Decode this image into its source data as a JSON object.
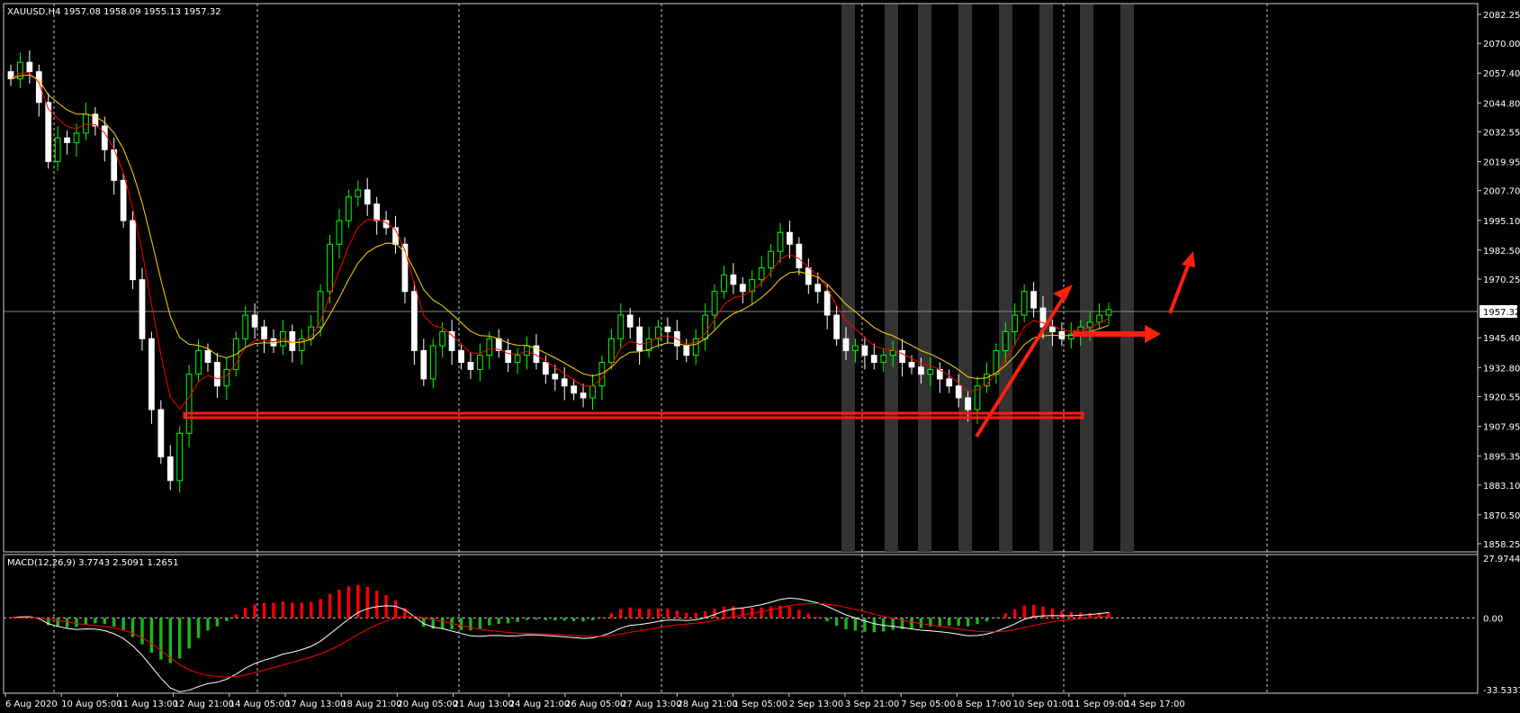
{
  "main_chart": {
    "header": "XAUUSD,H4  1957.08 1958.09 1955.13 1957.32",
    "price_labels": [
      "2082.25",
      "2070.00",
      "2057.40",
      "2044.80",
      "2032.55",
      "2019.95",
      "2007.70",
      "1995.10",
      "1982.50",
      "1970.25",
      "1957.32",
      "1945.40",
      "1932.80",
      "1920.55",
      "1907.95",
      "1895.35",
      "1883.10",
      "1870.50",
      "1858.25"
    ],
    "current_price": "1957.32"
  },
  "macd": {
    "header": "MACD(12,26,9) 3.7743 2.5091 1.2651",
    "scale_labels": [
      "27.9744",
      "0.00",
      "-33.5337"
    ]
  },
  "time_axis": {
    "labels": [
      "6 Aug 2020",
      "10 Aug 05:00",
      "11 Aug 13:00",
      "12 Aug 21:00",
      "14 Aug 05:00",
      "17 Aug 13:00",
      "18 Aug 21:00",
      "20 Aug 05:00",
      "21 Aug 13:00",
      "24 Aug 21:00",
      "26 Aug 05:00",
      "27 Aug 13:00",
      "28 Aug 21:00",
      "1 Sep 05:00",
      "2 Sep 13:00",
      "3 Sep 21:00",
      "7 Sep 05:00",
      "8 Sep 17:00",
      "10 Sep 01:00",
      "11 Sep 09:00",
      "14 Sep 17:00"
    ]
  },
  "chart_data": {
    "type": "candlestick",
    "symbol": "XAUUSD",
    "timeframe": "H4",
    "ylim": [
      1858.25,
      2082.25
    ],
    "close_series": [
      2055,
      2062,
      2058,
      2045,
      2020,
      2030,
      2028,
      2032,
      2040,
      2035,
      2025,
      2012,
      1995,
      1970,
      1945,
      1915,
      1895,
      1885,
      1905,
      1930,
      1940,
      1935,
      1925,
      1932,
      1945,
      1955,
      1950,
      1945,
      1942,
      1948,
      1940,
      1945,
      1950,
      1965,
      1985,
      1995,
      2005,
      2008,
      2002,
      1995,
      1992,
      1985,
      1965,
      1940,
      1928,
      1942,
      1948,
      1940,
      1935,
      1932,
      1938,
      1945,
      1940,
      1935,
      1938,
      1942,
      1935,
      1930,
      1928,
      1925,
      1922,
      1920,
      1925,
      1935,
      1945,
      1955,
      1950,
      1940,
      1945,
      1950,
      1948,
      1942,
      1938,
      1945,
      1955,
      1965,
      1972,
      1968,
      1965,
      1970,
      1975,
      1982,
      1990,
      1985,
      1975,
      1968,
      1965,
      1955,
      1945,
      1940,
      1942,
      1938,
      1935,
      1938,
      1940,
      1935,
      1933,
      1930,
      1932,
      1928,
      1925,
      1920,
      1915,
      1925,
      1930,
      1940,
      1948,
      1955,
      1965,
      1958,
      1950,
      1948,
      1945,
      1947,
      1950,
      1952,
      1955,
      1957.32
    ]
  },
  "colors": {
    "background": "#000000",
    "grid": "#ffffff",
    "bull_candle": "#00ff00",
    "bear_candle": "#ffffff",
    "ma_fast": "#ff0000",
    "ma_slow": "#ffd700",
    "support_line": "#ff0000",
    "arrow": "#ff2010",
    "macd_line": "#ffffff",
    "signal_line": "#ff0000",
    "hist_positive": "#ff0000",
    "hist_negative": "#1db51d",
    "session_band": "#333333"
  }
}
